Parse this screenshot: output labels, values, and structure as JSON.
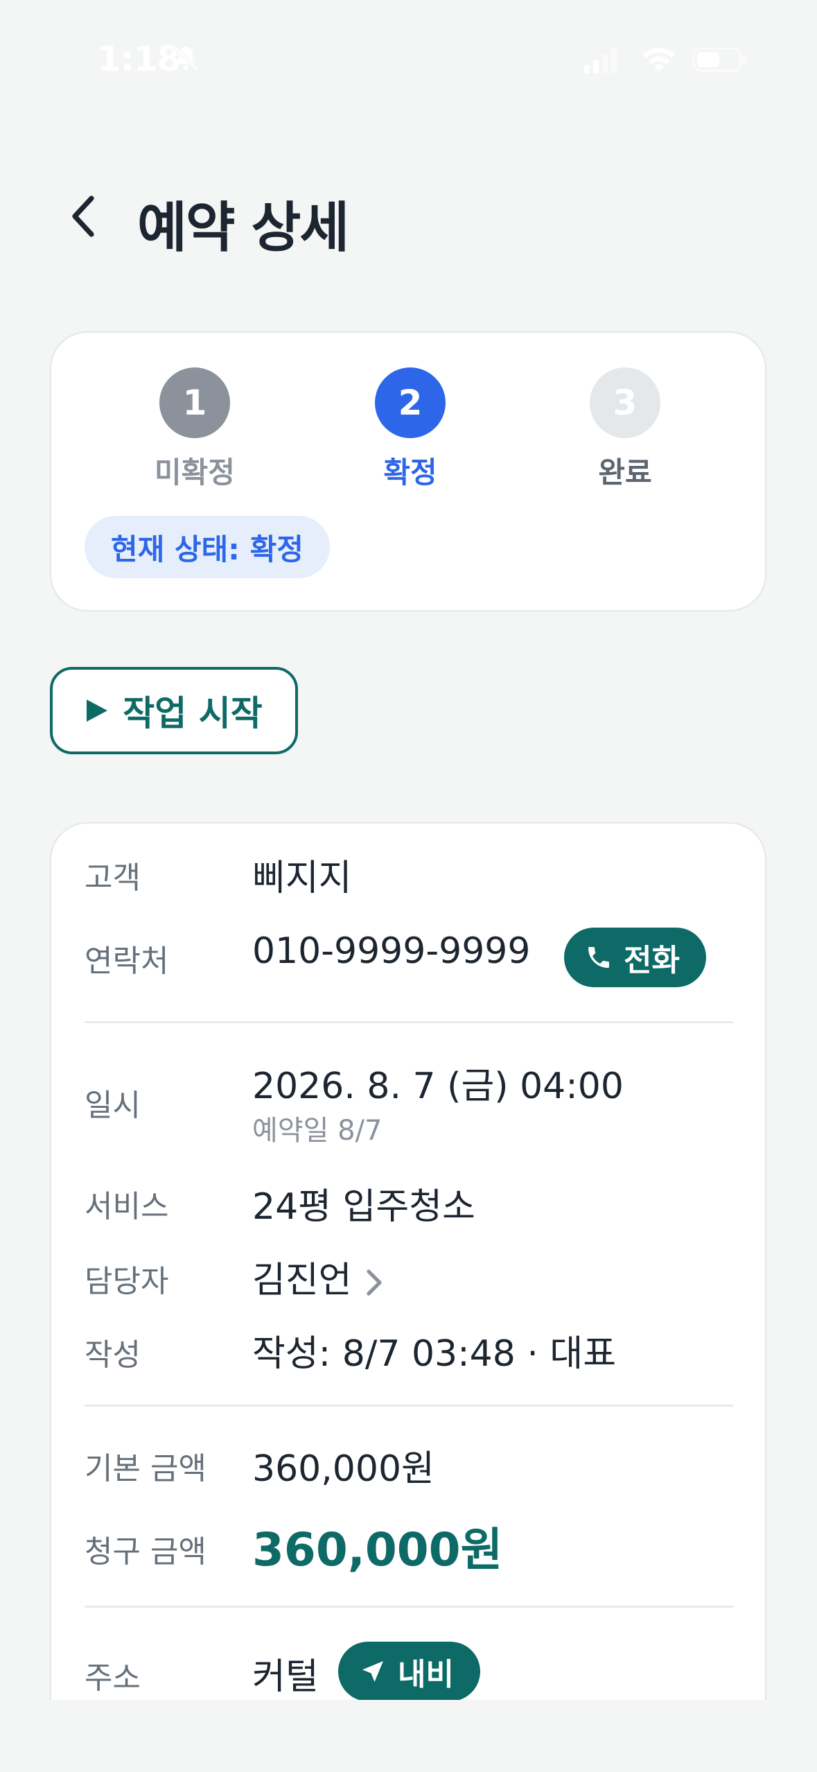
{
  "status_bar": {
    "time": "1:18"
  },
  "header": {
    "title": "예약 상세"
  },
  "progress": {
    "steps": [
      {
        "number": "1",
        "label": "미확정"
      },
      {
        "number": "2",
        "label": "확정"
      },
      {
        "number": "3",
        "label": "완료"
      }
    ],
    "current_step": 2,
    "current_status_text": "현재 상태: 확정"
  },
  "actions": {
    "start_work_label": "작업 시작"
  },
  "details": {
    "customer_label": "고객",
    "customer_value": "삐지지",
    "contact_label": "연락처",
    "contact_value": "010-9999-9999",
    "call_label": "전화",
    "datetime_label": "일시",
    "datetime_value": "2026. 8. 7 (금) 04:00",
    "reserved_date": "예약일 8/7",
    "service_label": "서비스",
    "service_value": "24평 입주청소",
    "manager_label": "담당자",
    "manager_value": "김진언",
    "created_label": "작성",
    "created_value": "작성: 8/7 03:48 · 대표",
    "base_amount_label": "기본 금액",
    "base_amount_value": "360,000원",
    "billed_amount_label": "청구 금액",
    "billed_amount_value": "360,000원",
    "address_label": "주소",
    "address_value": "커털",
    "navigate_label": "내비"
  },
  "colors": {
    "accent_teal": "#0e6a66",
    "accent_blue": "#2d66e8",
    "muted_gray": "#8b929b",
    "background": "#f4f5f5"
  }
}
